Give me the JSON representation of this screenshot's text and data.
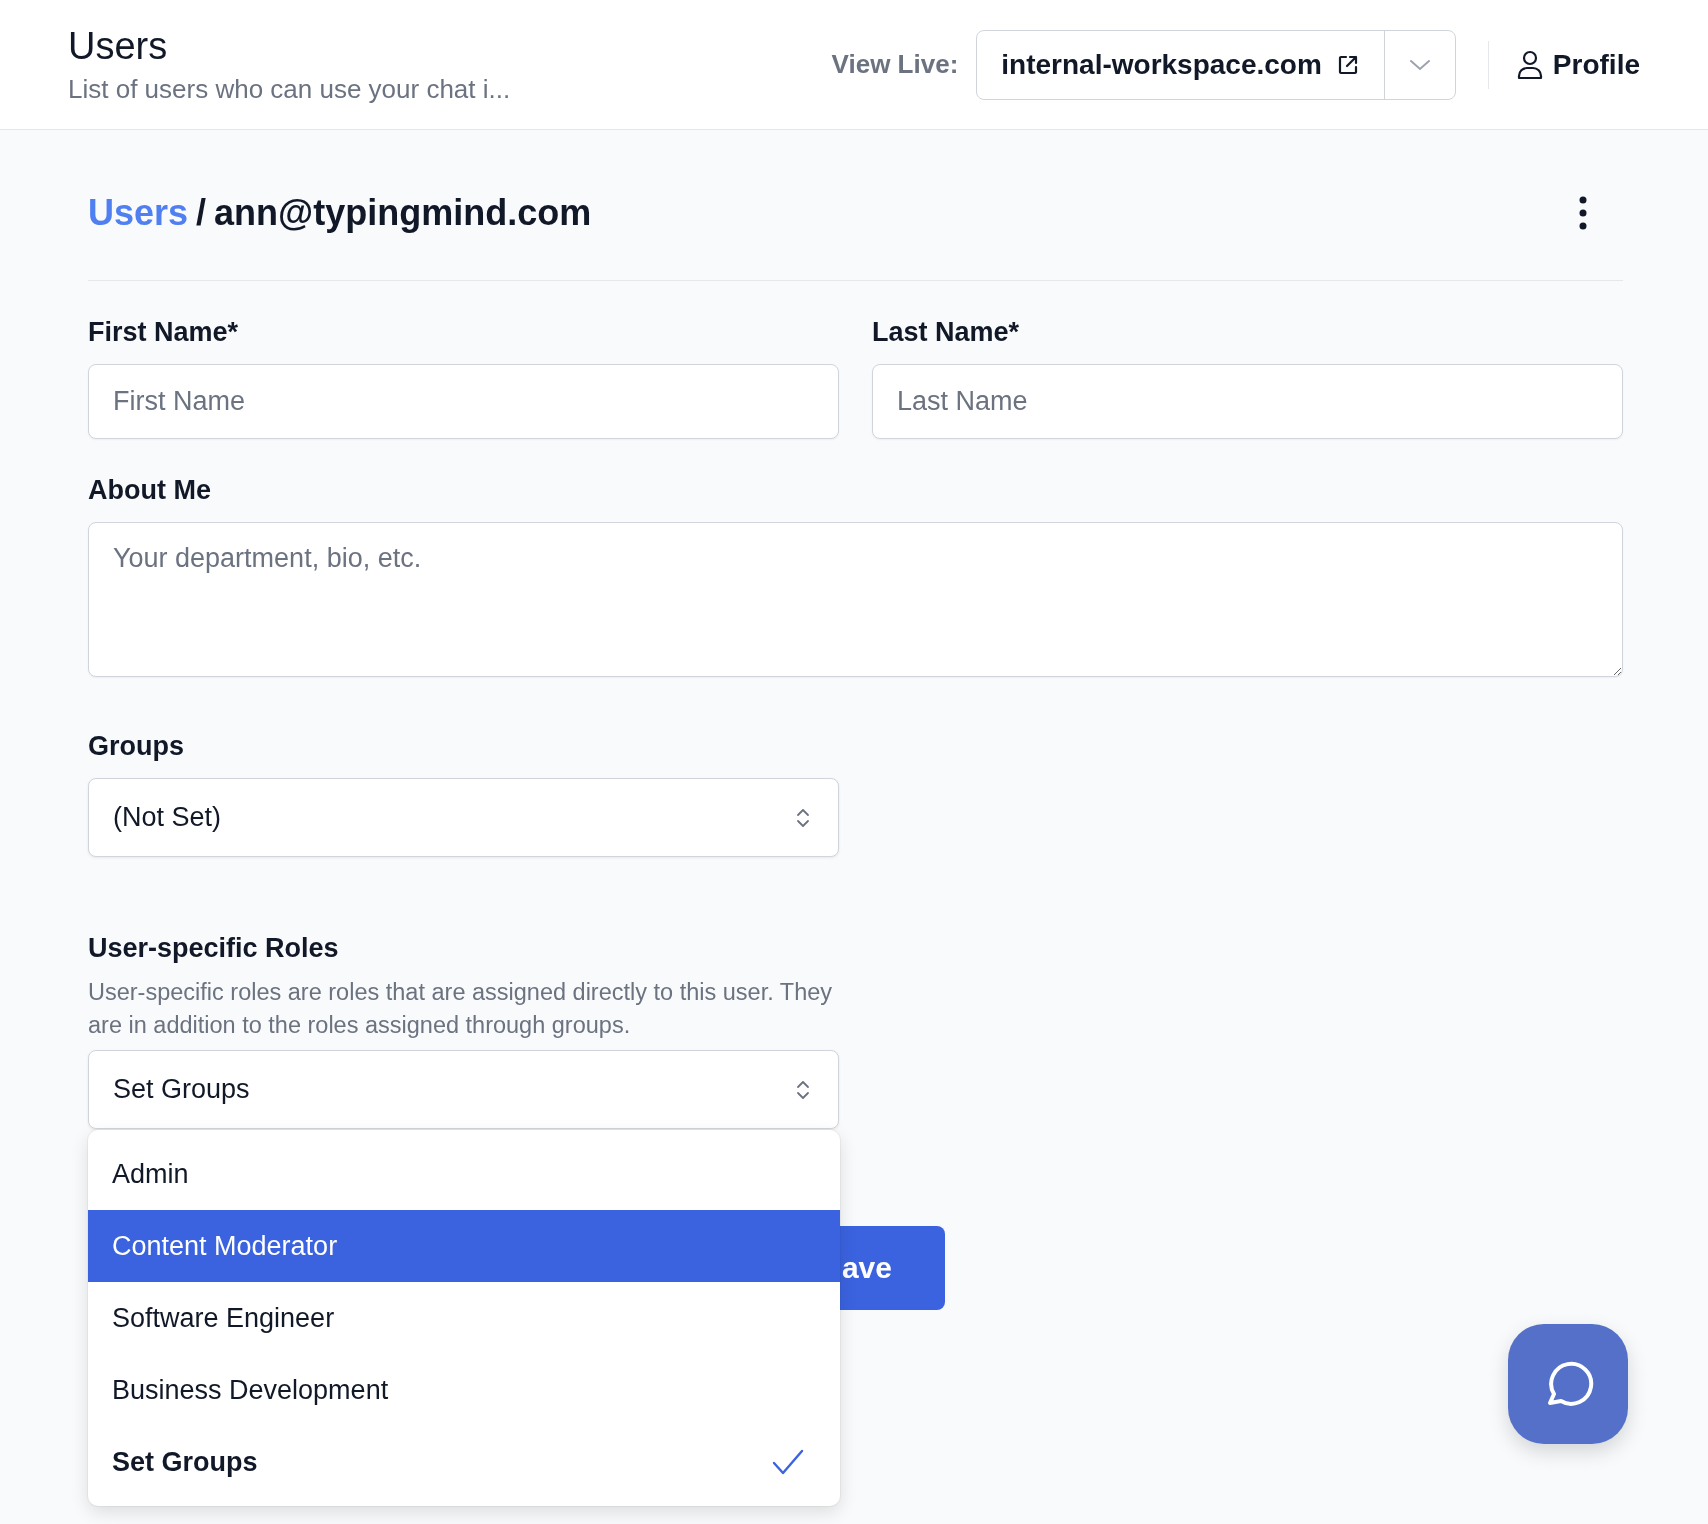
{
  "header": {
    "title": "Users",
    "subtitle": "List of users who can use your chat i...",
    "view_live_label": "View Live:",
    "domain": "internal-workspace.com",
    "profile": "Profile"
  },
  "breadcrumb": {
    "parent": "Users",
    "separator": "/",
    "current": "ann@typingmind.com"
  },
  "fields": [
    {
      "label": "First Name*",
      "placeholder": "First Name"
    },
    {
      "label": "Last Name*",
      "placeholder": "Last Name"
    }
  ],
  "about": {
    "label": "About Me",
    "placeholder": "Your department, bio, etc."
  },
  "groups": {
    "label": "Groups",
    "value": "(Not Set)"
  },
  "roles": {
    "label": "User-specific Roles",
    "description": "User-specific roles are roles that are assigned directly to this user. They are in addition to the roles assigned through groups.",
    "value": "Set Groups",
    "options": [
      {
        "label": "Admin",
        "highlighted": false,
        "selected": false
      },
      {
        "label": "Content Moderator",
        "highlighted": true,
        "selected": false
      },
      {
        "label": "Software Engineer",
        "highlighted": false,
        "selected": false
      },
      {
        "label": "Business Development",
        "highlighted": false,
        "selected": false
      },
      {
        "label": "Set Groups",
        "highlighted": false,
        "selected": true
      }
    ]
  },
  "save_button": "ave"
}
